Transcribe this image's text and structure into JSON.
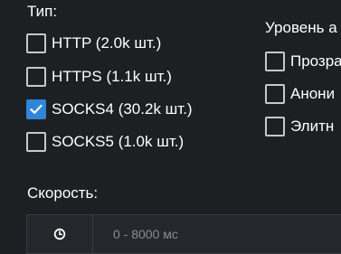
{
  "type_filter": {
    "title": "Тип:",
    "options": [
      {
        "label": "HTTP (2.0k шт.)",
        "checked": false
      },
      {
        "label": "HTTPS (1.1k шт.)",
        "checked": false
      },
      {
        "label": "SOCKS4 (30.2k шт.)",
        "checked": true
      },
      {
        "label": "SOCKS5 (1.0k шт.)",
        "checked": false
      }
    ]
  },
  "anonymity_filter": {
    "title": "Уровень а",
    "options": [
      {
        "label": "Прозра",
        "checked": false
      },
      {
        "label": "Анони",
        "checked": false
      },
      {
        "label": "Элитн",
        "checked": false
      }
    ]
  },
  "speed_filter": {
    "title": "Скорость:",
    "placeholder": "0 - 8000 мс",
    "icon": "clock-icon"
  },
  "colors": {
    "background": "#1e1f23",
    "checked": "#2f86d6",
    "checkbox_border": "#c8c8c8",
    "input_bg": "#25272c"
  }
}
